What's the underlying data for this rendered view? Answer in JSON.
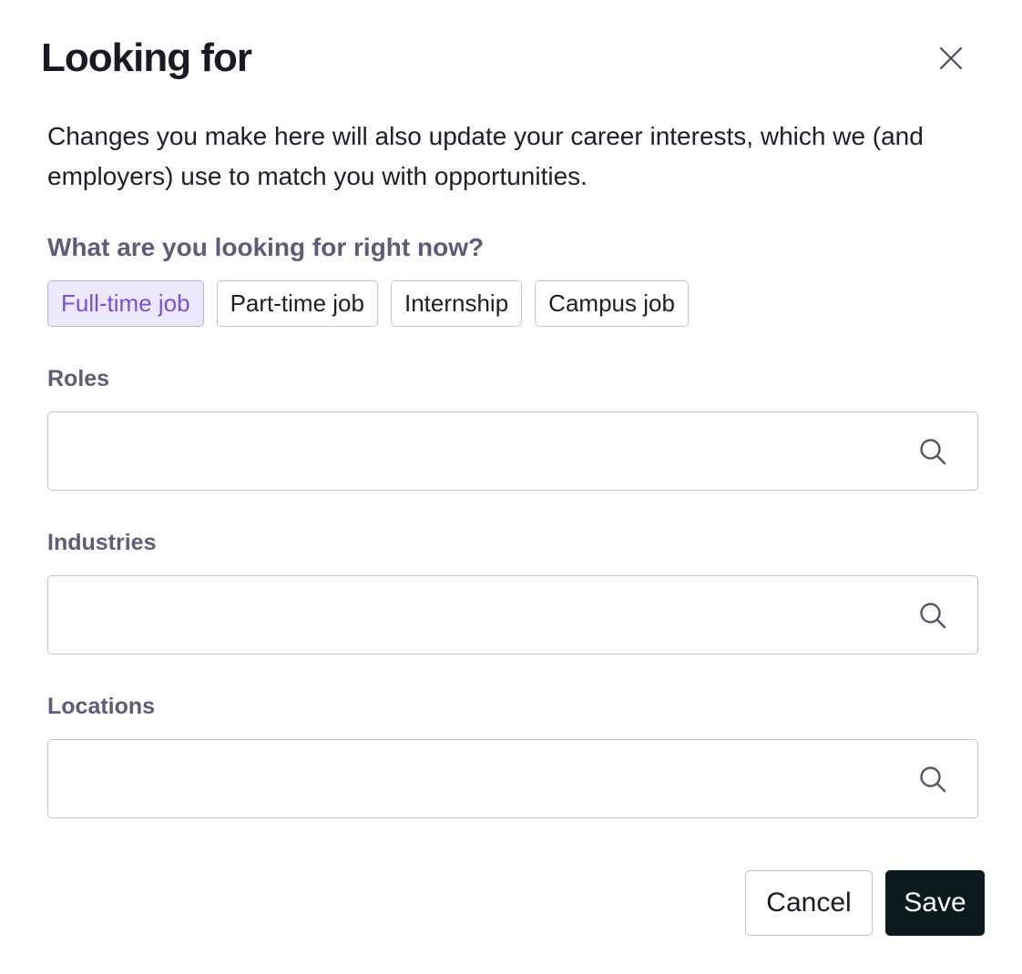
{
  "dialog": {
    "title": "Looking for",
    "intro": "Changes you make here will also update your career interests, which we (and employers) use to match you with opportunities.",
    "close_icon": "close-icon"
  },
  "job_type": {
    "question": "What are you looking for right now?",
    "options": [
      {
        "label": "Full-time job",
        "selected": true
      },
      {
        "label": "Part-time job",
        "selected": false
      },
      {
        "label": "Internship",
        "selected": false
      },
      {
        "label": "Campus job",
        "selected": false
      }
    ]
  },
  "fields": {
    "roles": {
      "label": "Roles",
      "value": "",
      "icon": "search-icon"
    },
    "industries": {
      "label": "Industries",
      "value": "",
      "icon": "search-icon"
    },
    "locations": {
      "label": "Locations",
      "value": "",
      "icon": "search-icon"
    }
  },
  "actions": {
    "cancel_label": "Cancel",
    "save_label": "Save"
  },
  "colors": {
    "selected_chip_bg": "#ece9fd",
    "selected_chip_text": "#7a4fe0",
    "label_text": "#5c5c7a",
    "save_bg": "#0b1a1d"
  }
}
